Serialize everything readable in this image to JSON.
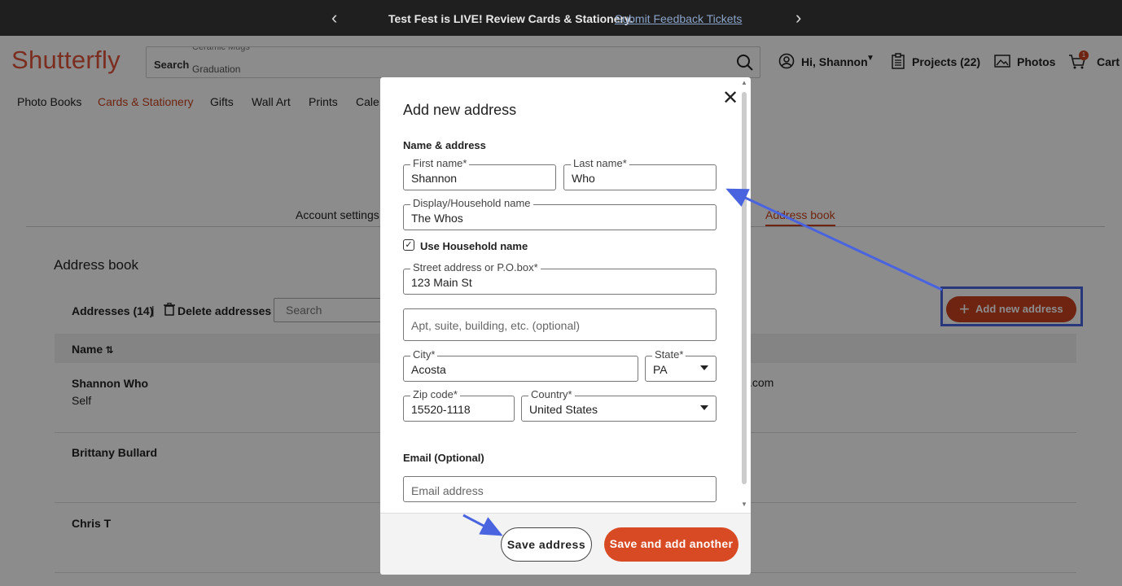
{
  "promo": {
    "text": "Test Fest is LIVE! Review Cards & Stationery.",
    "link": "Submit Feedback Tickets"
  },
  "header": {
    "logo": "Shutterfly",
    "search_label": "Search",
    "search_suggestion_1": "Ceramic Mugs",
    "search_suggestion_2": "Graduation",
    "account": "Hi, Shannon",
    "projects": "Projects (22)",
    "photos": "Photos",
    "cart": "Cart",
    "cart_count": "1"
  },
  "nav": {
    "items": [
      "Photo Books",
      "Cards & Stationery",
      "Gifts",
      "Wall Art",
      "Prints",
      "Cale"
    ]
  },
  "tabs": {
    "account_settings": "Account settings",
    "address_book": "Address book"
  },
  "page": {
    "title": "Address book",
    "count": "Addresses (14)",
    "separator": "|",
    "delete": "Delete addresses",
    "search_placeholder": "Search",
    "add_button": "Add new address",
    "name_header": "Name",
    "email_fragment": ".com",
    "rows": [
      {
        "name": "Shannon Who",
        "sub": "Self"
      },
      {
        "name": "Brittany Bullard",
        "sub": ""
      },
      {
        "name": "Chris T",
        "sub": ""
      }
    ]
  },
  "modal": {
    "title": "Add new address",
    "section_name_address": "Name & address",
    "first_name_label": "First name*",
    "first_name_value": "Shannon",
    "last_name_label": "Last name*",
    "last_name_value": "Who",
    "display_label": "Display/Household name",
    "display_value": "The Whos",
    "use_household": "Use Household name",
    "street_label": "Street address or P.O.box*",
    "street_value": "123 Main St",
    "apt_placeholder": "Apt, suite, building, etc. (optional)",
    "city_label": "City*",
    "city_value": "Acosta",
    "state_label": "State*",
    "state_value": "PA",
    "zip_label": "Zip code*",
    "zip_value": "15520-1118",
    "country_label": "Country*",
    "country_value": "United States",
    "email_section": "Email (Optional)",
    "email_placeholder": "Email address",
    "save_button": "Save address",
    "save_add_button": "Save and add another"
  },
  "colors": {
    "brand": "#e0533a",
    "accent": "#c8431f",
    "annotation": "#4a64e0"
  }
}
